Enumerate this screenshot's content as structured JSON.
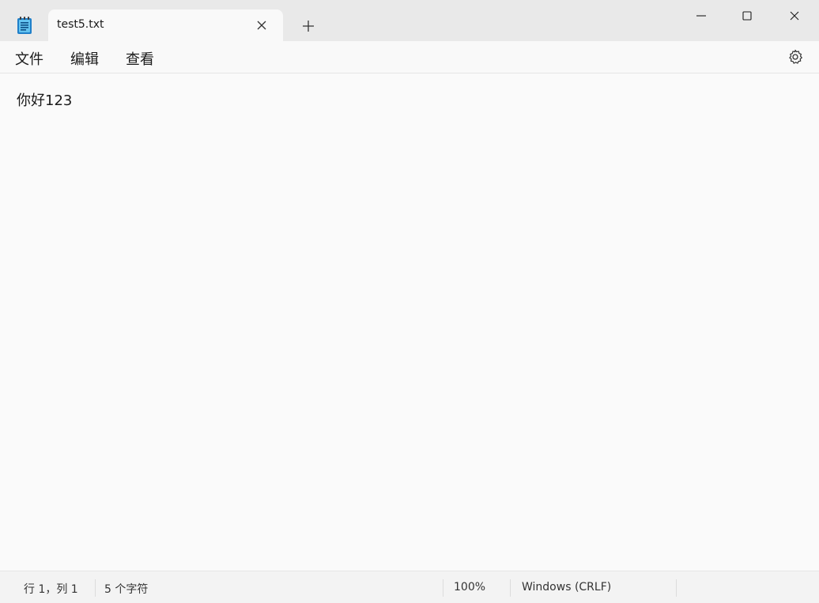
{
  "tab": {
    "title": "test5.txt"
  },
  "menu": {
    "file": "文件",
    "edit": "编辑",
    "view": "查看"
  },
  "editor": {
    "content": "你好123"
  },
  "status": {
    "position": "行 1，列 1",
    "chars": "5 个字符",
    "zoom": "100%",
    "line_ending": "Windows (CRLF)"
  },
  "icons": {
    "app": "notepad-icon",
    "tab_close": "close-icon",
    "new_tab": "plus-icon",
    "minimize": "minimize-icon",
    "maximize": "maximize-icon",
    "close": "close-icon",
    "settings": "gear-icon"
  },
  "colors": {
    "titlebar": "#e9e9e9",
    "editor_bg": "#fafafa",
    "accent": "#2b8fd6"
  }
}
